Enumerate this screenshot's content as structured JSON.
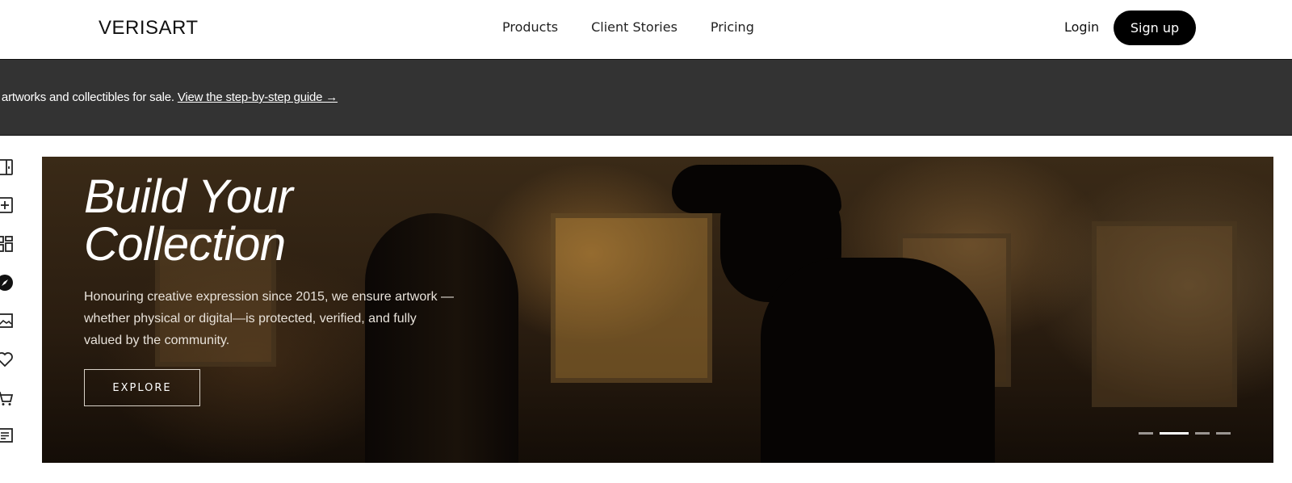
{
  "header": {
    "logo": "VERISART",
    "nav": [
      "Products",
      "Client Stories",
      "Pricing"
    ],
    "login": "Login",
    "signup": "Sign up"
  },
  "banner": {
    "text": "t artworks and collectibles for sale. ",
    "link": "View the step-by-step guide →"
  },
  "sidebar": {
    "icons": [
      "panel-toggle-icon",
      "add-square-icon",
      "dashboard-grid-icon",
      "compass-icon",
      "image-icon",
      "heart-icon",
      "cart-icon",
      "list-icon"
    ]
  },
  "hero": {
    "title_line1": "Build Your",
    "title_line2": "Collection",
    "description": "Honouring creative expression since 2015, we ensure artwork —whether physical or digital—is protected, verified, and fully valued by the community.",
    "cta": "EXPLORE",
    "slides": 4,
    "active_slide": 2
  }
}
